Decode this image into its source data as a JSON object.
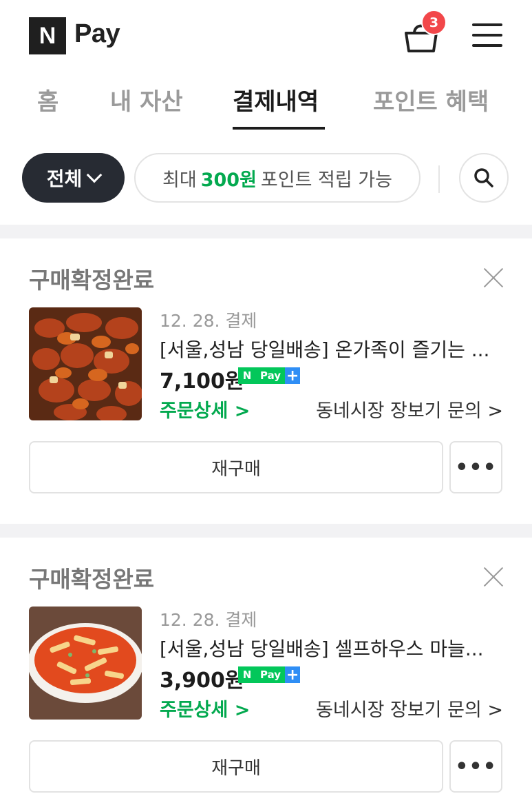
{
  "header": {
    "logo_letter": "N",
    "logo_text": "Pay",
    "cart_count": "3"
  },
  "tabs": [
    {
      "label": "홈"
    },
    {
      "label": "내 자산"
    },
    {
      "label": "결제내역",
      "active": true
    },
    {
      "label": "포인트 혜택"
    }
  ],
  "filter": {
    "all_label": "전체",
    "point_prefix": "최대",
    "point_amount": "300원",
    "point_suffix": "포인트 적립 가능"
  },
  "orders": [
    {
      "status": "구매확정완료",
      "date": "12. 28. 결제",
      "name": "[서울,성남 당일배송] 온가족이 즐기는 ...",
      "price": "7,100원",
      "order_detail": "주문상세 >",
      "inquiry": "동네시장 장보기 문의 >",
      "rebuy": "재구매",
      "more": "•••"
    },
    {
      "status": "구매확정완료",
      "date": "12. 28. 결제",
      "name": "[서울,성남 당일배송] 셀프하우스 마늘...",
      "price": "3,900원",
      "order_detail": "주문상세 >",
      "inquiry": "동네시장 장보기 문의 >",
      "rebuy": "재구매",
      "more": "•••"
    }
  ],
  "badge": {
    "n": "N",
    "pay": "Pay",
    "plus": "+"
  },
  "colors": {
    "accent_green": "#03a94f",
    "npay_green": "#03c75a",
    "badge_red": "#f2474a",
    "dark_chip": "#272b33"
  }
}
